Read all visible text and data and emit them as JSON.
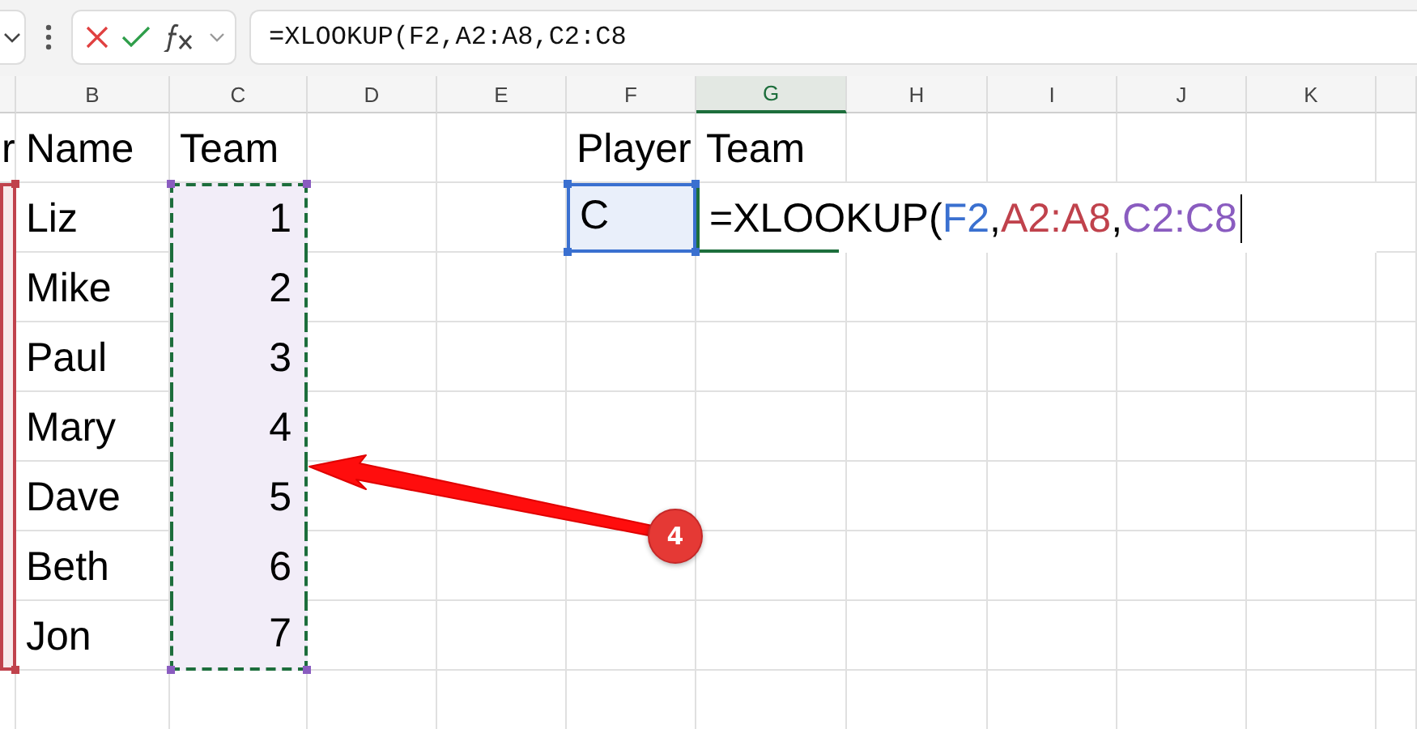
{
  "formula_bar": {
    "formula": "=XLOOKUP(F2,A2:A8,C2:C8"
  },
  "sheet": {
    "columns": [
      {
        "label": "B",
        "selected": false
      },
      {
        "label": "C",
        "selected": false
      },
      {
        "label": "D",
        "selected": false
      },
      {
        "label": "E",
        "selected": false
      },
      {
        "label": "F",
        "selected": false
      },
      {
        "label": "G",
        "selected": true
      },
      {
        "label": "H",
        "selected": false
      },
      {
        "label": "I",
        "selected": false
      },
      {
        "label": "J",
        "selected": false
      },
      {
        "label": "K",
        "selected": false
      }
    ],
    "rows": [
      {
        "A": "r",
        "B": "Name",
        "C": "Team",
        "F": "Player",
        "G": "Team"
      },
      {
        "B": "Liz",
        "C": "1",
        "F": "C",
        "G": {
          "parts": [
            {
              "text": "=XLOOKUP(",
              "color": "#000000",
              "kind": "plain"
            },
            {
              "text": "F2",
              "color": "#3a70d0",
              "kind": "reference",
              "marching": false
            },
            {
              "text": ",",
              "color": "#000000",
              "kind": "plain"
            },
            {
              "text": "A2:A8",
              "color": "#c0424c",
              "kind": "reference",
              "marching": false
            },
            {
              "text": ",",
              "color": "#000000",
              "kind": "plain"
            },
            {
              "text": "C2:C8",
              "color": "#8a5cc0",
              "kind": "reference",
              "marching": true
            }
          ]
        }
      },
      {
        "B": "Mike",
        "C": "2"
      },
      {
        "B": "Paul",
        "C": "3"
      },
      {
        "B": "Mary",
        "C": "4"
      },
      {
        "B": "Dave",
        "C": "5"
      },
      {
        "B": "Beth",
        "C": "6"
      },
      {
        "B": "Jon",
        "C": "7"
      }
    ]
  },
  "callout": {
    "label": "4"
  }
}
